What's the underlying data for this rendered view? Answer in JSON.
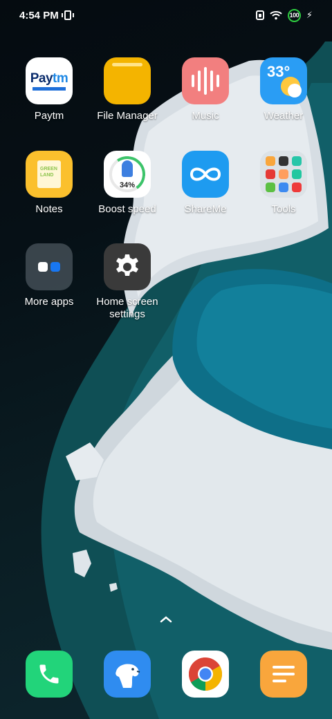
{
  "status_bar": {
    "time": "4:54 PM",
    "battery_level": "100",
    "icons": [
      "vibrate-icon",
      "sim-icon",
      "wifi-icon",
      "battery-icon",
      "charging-icon"
    ]
  },
  "apps": [
    {
      "id": "paytm",
      "label": "Paytm",
      "icon_text_a": "Pay",
      "icon_text_b": "tm"
    },
    {
      "id": "file-manager",
      "label": "File Manager"
    },
    {
      "id": "music",
      "label": "Music"
    },
    {
      "id": "weather",
      "label": "Weather",
      "icon_text": "33°"
    },
    {
      "id": "notes",
      "label": "Notes",
      "icon_text": "GREEN LAND"
    },
    {
      "id": "boost-speed",
      "label": "Boost speed",
      "icon_text": "34%",
      "progress": 0.34
    },
    {
      "id": "shareme",
      "label": "ShareMe"
    },
    {
      "id": "tools",
      "label": "Tools"
    },
    {
      "id": "more-apps",
      "label": "More apps"
    },
    {
      "id": "home-screen-settings",
      "label": "Home screen settings"
    }
  ],
  "dock": [
    {
      "id": "phone",
      "icon": "phone-icon"
    },
    {
      "id": "browser",
      "icon": "polar-bear-browser-icon"
    },
    {
      "id": "chrome",
      "icon": "chrome-icon"
    },
    {
      "id": "menu-app",
      "icon": "menu-lines-icon"
    }
  ],
  "colors": {
    "battery_ring": "#2ecc40",
    "paytm_blue": "#0a2c6c",
    "file_manager": "#f4b400",
    "music": "#f27f7f",
    "weather": "#2a9df4",
    "notes": "#fbc02d",
    "shareme": "#1e9bf0",
    "phone": "#22d47a",
    "chrome_red": "#db4437",
    "chrome_yellow": "#f4b400",
    "chrome_green": "#0f9d58",
    "chrome_blue": "#4285f4",
    "menu_app": "#f9a63c"
  }
}
